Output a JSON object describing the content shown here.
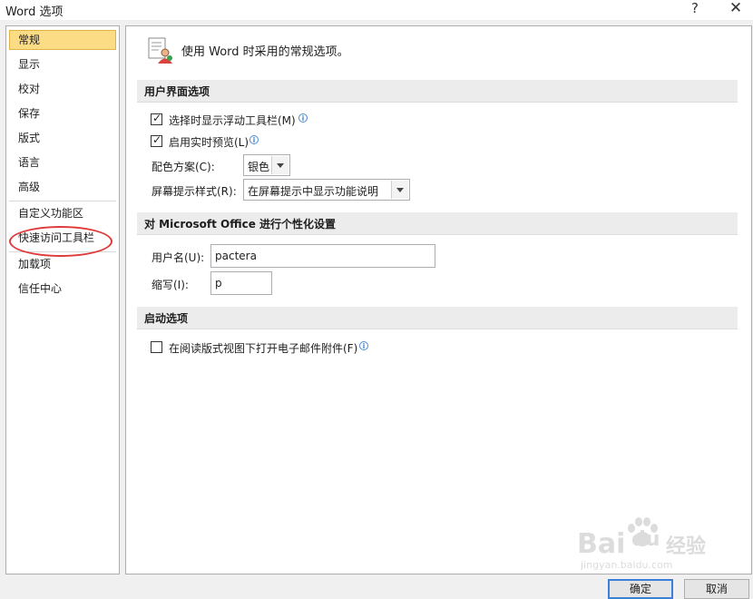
{
  "window": {
    "title": "Word 选项",
    "help_label": "?",
    "close_label": "✕"
  },
  "sidebar": {
    "items": [
      {
        "label": "常规"
      },
      {
        "label": "显示"
      },
      {
        "label": "校对"
      },
      {
        "label": "保存"
      },
      {
        "label": "版式"
      },
      {
        "label": "语言"
      },
      {
        "label": "高级"
      },
      {
        "label": "自定义功能区"
      },
      {
        "label": "快速访问工具栏"
      },
      {
        "label": "加载项"
      },
      {
        "label": "信任中心"
      }
    ],
    "selected": "常规",
    "annotation_color": "#e03a3a"
  },
  "main": {
    "header_text": "使用 Word 时采用的常规选项。",
    "ui_section": {
      "title": "用户界面选项",
      "float_toolbar_label": "选择时显示浮动工具栏(M)",
      "float_toolbar_checked": true,
      "live_preview_label": "启用实时预览(L)",
      "live_preview_checked": true,
      "color_scheme_label": "配色方案(C):",
      "color_scheme_value": "银色",
      "screentip_label": "屏幕提示样式(R):",
      "screentip_value": "在屏幕提示中显示功能说明"
    },
    "personal_section": {
      "title": "对 Microsoft Office 进行个性化设置",
      "username_label": "用户名(U):",
      "username_value": "pactera",
      "initials_label": "缩写(I):",
      "initials_value": "p"
    },
    "startup_section": {
      "title": "启动选项",
      "open_reading_label": "在阅读版式视图下打开电子邮件附件(F)",
      "open_reading_checked": false
    }
  },
  "watermark": {
    "text": "Bai",
    "text2": "du",
    "text3": "经验",
    "sub": "jingyan.baidu.com"
  },
  "footer": {
    "ok_label": "确定",
    "cancel_label": "取消"
  },
  "colors": {
    "selected_bg": "#fddc86",
    "ok_border": "#3c7fd7"
  }
}
